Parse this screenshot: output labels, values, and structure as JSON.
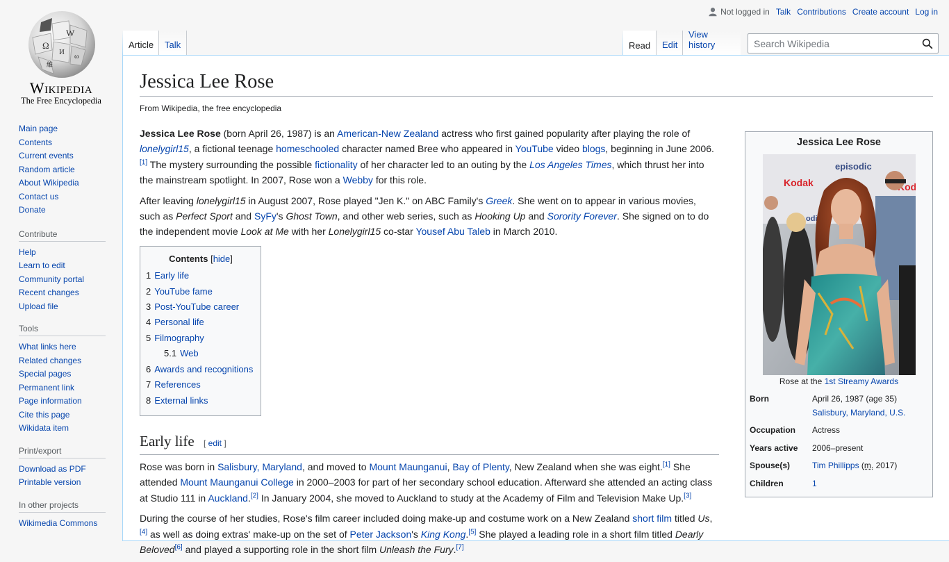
{
  "logo": {
    "wordmark": "Wikipedia",
    "tagline": "The Free Encyclopedia",
    "icon": "puzzle-globe-logo"
  },
  "personal": {
    "status": "Not logged in",
    "talk": "Talk",
    "contributions": "Contributions",
    "create_account": "Create account",
    "login": "Log in"
  },
  "tabs": {
    "article": "Article",
    "talk": "Talk",
    "read": "Read",
    "edit": "Edit",
    "history": "View history"
  },
  "search": {
    "placeholder": "Search Wikipedia"
  },
  "sidebar": {
    "navigation": [
      "Main page",
      "Contents",
      "Current events",
      "Random article",
      "About Wikipedia",
      "Contact us",
      "Donate"
    ],
    "contribute": {
      "heading": "Contribute",
      "items": [
        "Help",
        "Learn to edit",
        "Community portal",
        "Recent changes",
        "Upload file"
      ]
    },
    "tools": {
      "heading": "Tools",
      "items": [
        "What links here",
        "Related changes",
        "Special pages",
        "Permanent link",
        "Page information",
        "Cite this page",
        "Wikidata item"
      ]
    },
    "print": {
      "heading": "Print/export",
      "items": [
        "Download as PDF",
        "Printable version"
      ]
    },
    "projects": {
      "heading": "In other projects",
      "items": [
        "Wikimedia Commons"
      ]
    }
  },
  "article": {
    "title": "Jessica Lee Rose",
    "subtitle": "From Wikipedia, the free encyclopedia"
  },
  "toc": {
    "title": "Contents",
    "hide": "hide",
    "items": [
      {
        "num": "1",
        "label": "Early life"
      },
      {
        "num": "2",
        "label": "YouTube fame"
      },
      {
        "num": "3",
        "label": "Post-YouTube career"
      },
      {
        "num": "4",
        "label": "Personal life"
      },
      {
        "num": "5",
        "label": "Filmography"
      },
      {
        "num": "5.1",
        "label": "Web"
      },
      {
        "num": "6",
        "label": "Awards and recognitions"
      },
      {
        "num": "7",
        "label": "References"
      },
      {
        "num": "8",
        "label": "External links"
      }
    ]
  },
  "sections": {
    "early_life": "Early life",
    "edit": "edit"
  },
  "infobox": {
    "title": "Jessica Lee Rose",
    "caption_prefix": "Rose at the ",
    "caption_link": "1st Streamy Awards",
    "photo_text": [
      "episodic",
      "Kodak",
      "Kodak",
      "odic"
    ],
    "rows": {
      "born_label": "Born",
      "born_date": "April 26, 1987 (age 35)",
      "born_place": "Salisbury, Maryland, U.S.",
      "occupation_label": "Occupation",
      "occupation": "Actress",
      "years_label": "Years active",
      "years": "2006–present",
      "spouse_label": "Spouse(s)",
      "spouse_name": "Tim Phillipps",
      "spouse_m": "m.",
      "spouse_year": "2017",
      "children_label": "Children",
      "children": "1"
    }
  },
  "colors": {
    "link": "#0645ad",
    "text": "#202122",
    "border": "#a2a9b1",
    "sidebar_bg": "#f6f6f6"
  }
}
